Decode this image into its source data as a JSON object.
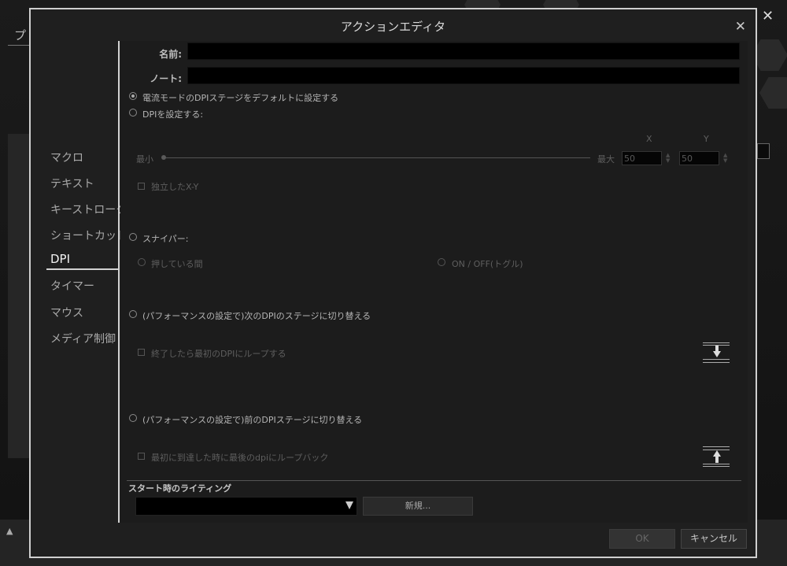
{
  "modal": {
    "title": "アクションエディタ",
    "close_glyph": "✕"
  },
  "sidebar": {
    "items": [
      {
        "label": "マクロ"
      },
      {
        "label": "テキスト"
      },
      {
        "label": "キーストローク"
      },
      {
        "label": "ショートカット"
      },
      {
        "label": "DPI"
      },
      {
        "label": "タイマー"
      },
      {
        "label": "マウス"
      },
      {
        "label": "メディア制御"
      }
    ],
    "active": "DPI"
  },
  "form": {
    "name_label": "名前:",
    "name_value": "",
    "note_label": "ノート:",
    "note_value": ""
  },
  "dpi": {
    "option_default": "電流モードのDPIステージをデフォルトに設定する",
    "option_set": "DPIを設定する:",
    "x_label": "X",
    "y_label": "Y",
    "min_label": "最小",
    "max_label": "最大",
    "x_value": "50",
    "y_value": "50",
    "independent_xy": "独立したX-Y",
    "sniper": "スナイパー:",
    "sniper_hold": "押している間",
    "sniper_toggle": "ON / OFF(トグル)",
    "next_stage": "(パフォーマンスの設定で)次のDPIのステージに切り替える",
    "loop_first": "終了したら最初のDPIにループする",
    "prev_stage": "(パフォーマンスの設定で)前のDPIステージに切り替える",
    "loop_last": "最初に到達した時に最後のdpiにループバック"
  },
  "lighting": {
    "title": "スタート時のライティング",
    "selected": "",
    "new_label": "新規..."
  },
  "footer": {
    "ok_label": "OK",
    "cancel_label": "キャンセル"
  },
  "background": {
    "tab_label": "プ",
    "close_glyph": "✕"
  }
}
